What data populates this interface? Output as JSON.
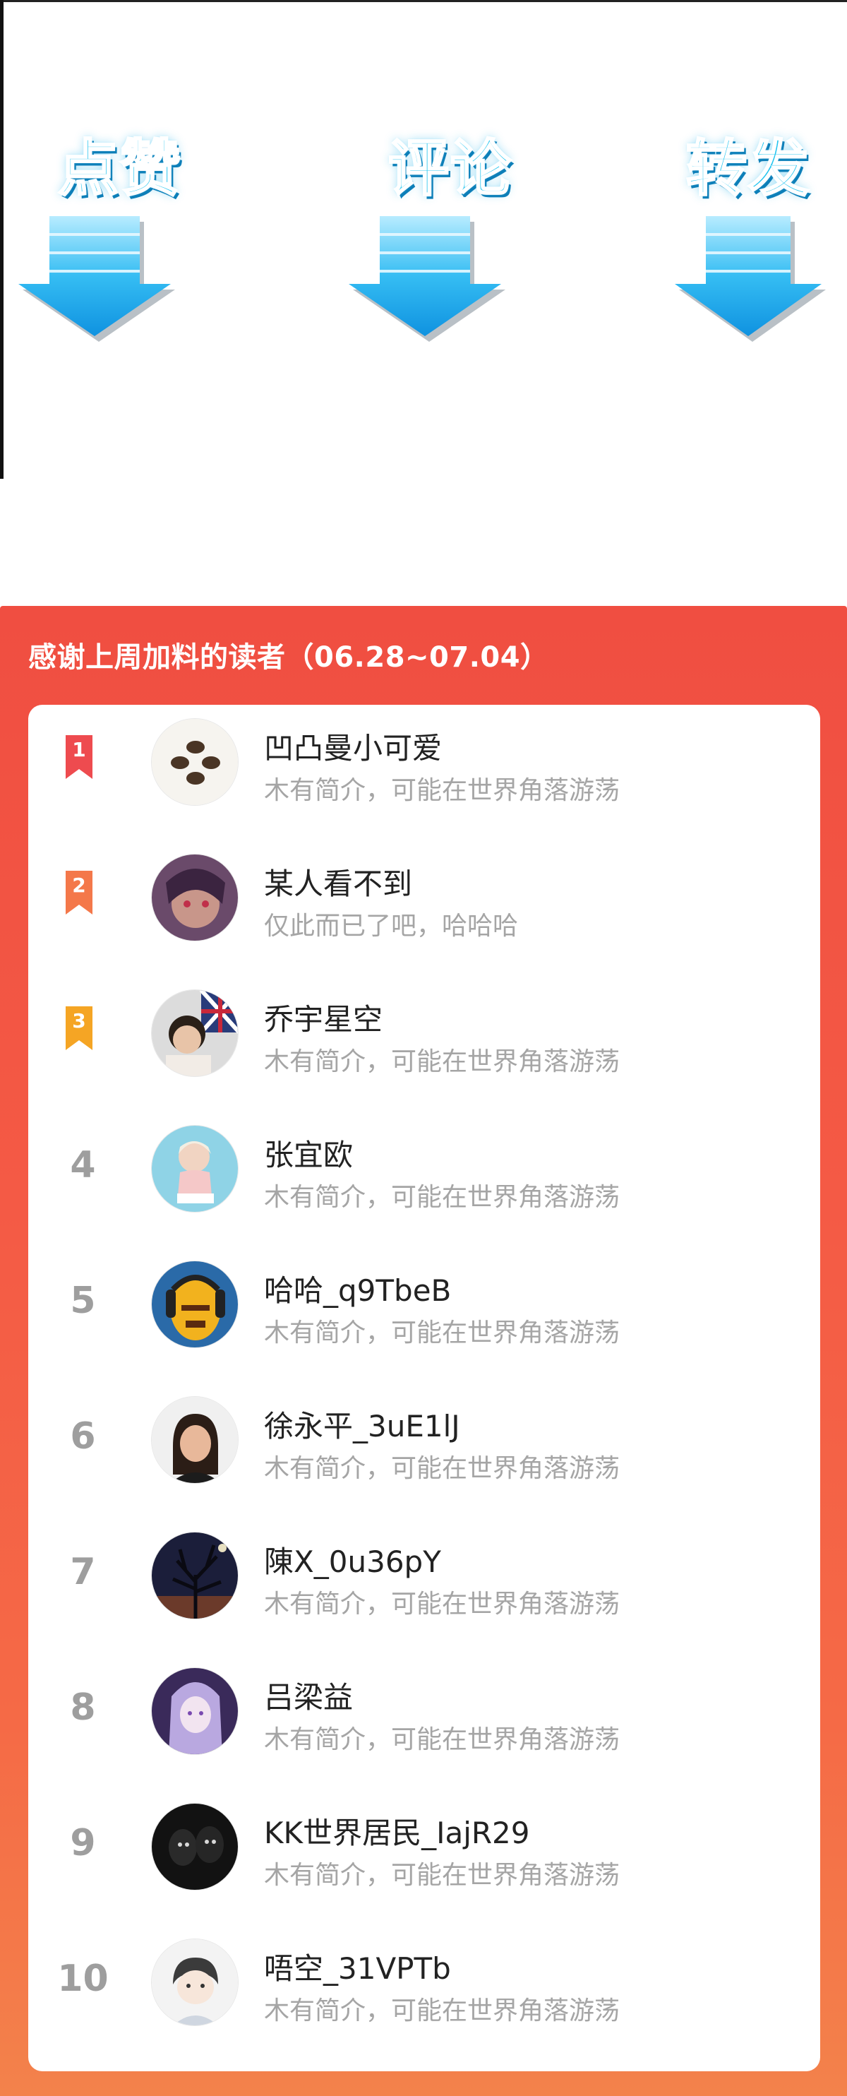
{
  "actions": [
    {
      "label": "点赞",
      "icon": "down-arrow-icon"
    },
    {
      "label": "评论",
      "icon": "down-arrow-icon"
    },
    {
      "label": "转发",
      "icon": "down-arrow-icon"
    }
  ],
  "colors": {
    "action_text": "#1ec3ef",
    "panel_red": "#f04e41",
    "panel_orange": "#f3824b",
    "rank1": "#ee4b4f",
    "rank2": "#f4784a",
    "rank3": "#f5a524",
    "rank_gray": "#9e9e9e"
  },
  "leaderboard": {
    "title": "感谢上周加料的读者（06.28~07.04）",
    "readers": [
      {
        "rank": "1",
        "name": "凹凸曼小可爱",
        "bio": "木有简介，可能在世界角落游荡"
      },
      {
        "rank": "2",
        "name": "某人看不到",
        "bio": "仅此而已了吧，哈哈哈"
      },
      {
        "rank": "3",
        "name": "乔宇星空",
        "bio": "木有简介，可能在世界角落游荡"
      },
      {
        "rank": "4",
        "name": "张宜欧",
        "bio": "木有简介，可能在世界角落游荡"
      },
      {
        "rank": "5",
        "name": "哈哈_q9TbeB",
        "bio": "木有简介，可能在世界角落游荡"
      },
      {
        "rank": "6",
        "name": "徐永平_3uE1lJ",
        "bio": "木有简介，可能在世界角落游荡"
      },
      {
        "rank": "7",
        "name": "陳X_0u36pY",
        "bio": "木有简介，可能在世界角落游荡"
      },
      {
        "rank": "8",
        "name": "吕梁益",
        "bio": "木有简介，可能在世界角落游荡"
      },
      {
        "rank": "9",
        "name": "KK世界居民_IajR29",
        "bio": "木有简介，可能在世界角落游荡"
      },
      {
        "rank": "10",
        "name": "唔空_31VPTb",
        "bio": "木有简介，可能在世界角落游荡"
      }
    ]
  }
}
